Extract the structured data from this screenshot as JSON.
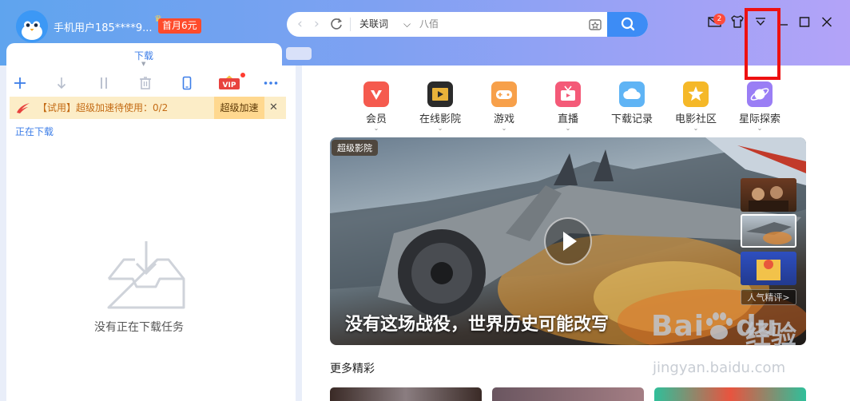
{
  "header": {
    "username": "手机用户185****9...",
    "promo_badge": "首月6元",
    "crown": "♛"
  },
  "searchbar": {
    "back_icon": "‹",
    "forward_icon": "›",
    "mode": "关联词",
    "chevron": "⌵",
    "query": "八佰"
  },
  "window_buttons": {
    "message_count": "2"
  },
  "download_panel": {
    "tab_label": "下载",
    "tab_caret": "▼",
    "trial_text": "【试用】超级加速待使用：0/2",
    "trial_button": "超级加速",
    "close": "✕",
    "section_label": "正在下载",
    "empty_text": "没有正在下载任务",
    "vip_label": "VIP"
  },
  "nav": [
    {
      "label": "会员",
      "icon": "vip-heart-icon",
      "color": "#f55a4e",
      "chevron": "⌄"
    },
    {
      "label": "在线影院",
      "icon": "film-icon",
      "color": "#2b2b2b",
      "chevron": "⌄"
    },
    {
      "label": "游戏",
      "icon": "gamepad-icon",
      "color": "#f7a04a",
      "chevron": "⌄"
    },
    {
      "label": "直播",
      "icon": "tv-icon",
      "color": "#f45a78",
      "chevron": "⌄"
    },
    {
      "label": "下载记录",
      "icon": "cloud-icon",
      "color": "#5fb4f5",
      "chevron": ""
    },
    {
      "label": "电影社区",
      "icon": "star-icon",
      "color": "#f5b828",
      "chevron": "⌄"
    },
    {
      "label": "星际探索",
      "icon": "planet-icon",
      "color": "#9a7ef5",
      "chevron": "⌄"
    }
  ],
  "banner": {
    "tag": "超级影院",
    "title": "没有这场战役，世界历史可能改写",
    "thumb_caption": "人气精评>"
  },
  "more": {
    "title": "更多精彩"
  },
  "watermark": {
    "brand": "Bai",
    "paw": "du",
    "cn": "经验",
    "url": "jingyan.baidu.com"
  }
}
